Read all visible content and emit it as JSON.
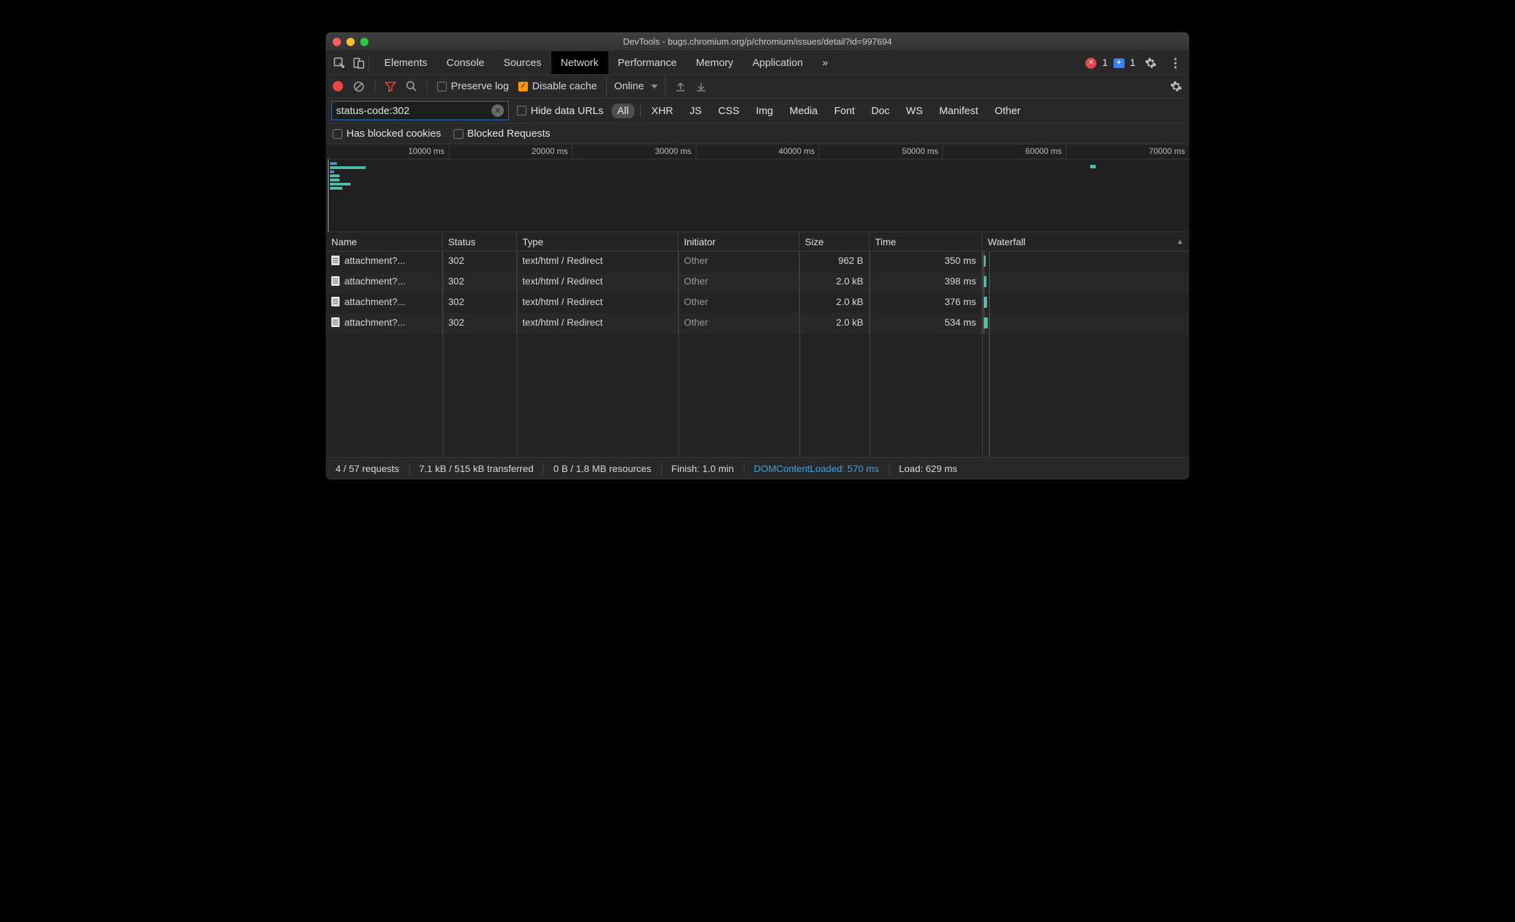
{
  "window": {
    "title": "DevTools - bugs.chromium.org/p/chromium/issues/detail?id=997694"
  },
  "tabs": {
    "items": [
      "Elements",
      "Console",
      "Sources",
      "Network",
      "Performance",
      "Memory",
      "Application"
    ],
    "active": "Network",
    "overflow": "»",
    "errorCount": "1",
    "infoCount": "1"
  },
  "toolbar": {
    "preserve_log": "Preserve log",
    "disable_cache": "Disable cache",
    "disable_cache_checked": true,
    "throttling": "Online"
  },
  "filter": {
    "value": "status-code:302",
    "hide_data_urls": "Hide data URLs",
    "types": [
      "All",
      "XHR",
      "JS",
      "CSS",
      "Img",
      "Media",
      "Font",
      "Doc",
      "WS",
      "Manifest",
      "Other"
    ],
    "active_type": "All",
    "has_blocked_cookies": "Has blocked cookies",
    "blocked_requests": "Blocked Requests"
  },
  "overview": {
    "ticks": [
      "10000 ms",
      "20000 ms",
      "30000 ms",
      "40000 ms",
      "50000 ms",
      "60000 ms",
      "70000 ms"
    ]
  },
  "grid": {
    "headers": {
      "name": "Name",
      "status": "Status",
      "type": "Type",
      "initiator": "Initiator",
      "size": "Size",
      "time": "Time",
      "waterfall": "Waterfall"
    },
    "rows": [
      {
        "name": "attachment?...",
        "status": "302",
        "type": "text/html / Redirect",
        "initiator": "Other",
        "size": "962 B",
        "time": "350 ms"
      },
      {
        "name": "attachment?...",
        "status": "302",
        "type": "text/html / Redirect",
        "initiator": "Other",
        "size": "2.0 kB",
        "time": "398 ms"
      },
      {
        "name": "attachment?...",
        "status": "302",
        "type": "text/html / Redirect",
        "initiator": "Other",
        "size": "2.0 kB",
        "time": "376 ms"
      },
      {
        "name": "attachment?...",
        "status": "302",
        "type": "text/html / Redirect",
        "initiator": "Other",
        "size": "2.0 kB",
        "time": "534 ms"
      }
    ]
  },
  "status": {
    "requests": "4 / 57 requests",
    "transferred": "7.1 kB / 515 kB transferred",
    "resources": "0 B / 1.8 MB resources",
    "finish": "Finish: 1.0 min",
    "dom": "DOMContentLoaded: 570 ms",
    "load": "Load: 629 ms"
  }
}
